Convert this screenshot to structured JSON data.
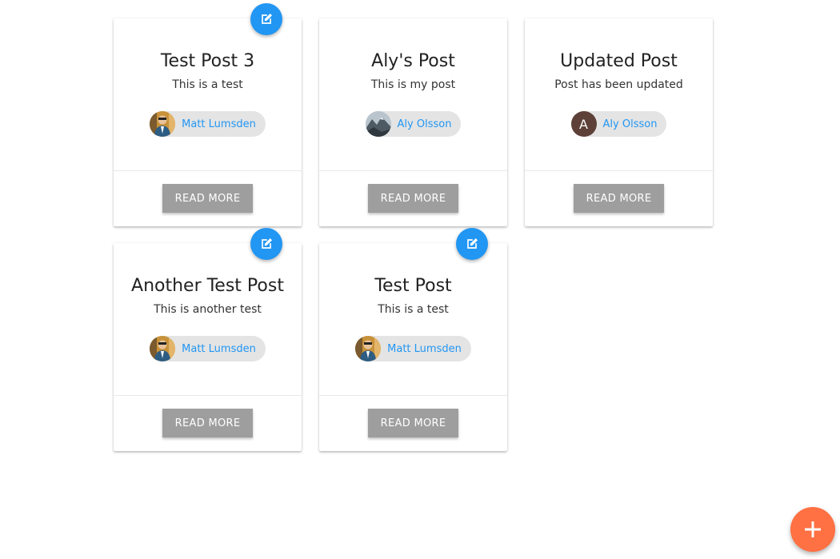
{
  "posts": [
    {
      "title": "Test Post 3",
      "body": "This is a test",
      "author": "Matt Lumsden",
      "avatar": "photo-matt",
      "button": "READ MORE",
      "editable": true
    },
    {
      "title": "Aly's Post",
      "body": "This is my post",
      "author": "Aly Olsson",
      "avatar": "photo-mountain",
      "button": "READ MORE",
      "editable": false
    },
    {
      "title": "Updated Post",
      "body": "Post has been updated",
      "author": "Aly Olsson",
      "avatar": "letter",
      "avatar_letter": "A",
      "button": "READ MORE",
      "editable": false
    },
    {
      "title": "Another Test Post",
      "body": "This is another test",
      "author": "Matt Lumsden",
      "avatar": "photo-matt",
      "button": "READ MORE",
      "editable": true
    },
    {
      "title": "Test Post",
      "body": "This is a test",
      "author": "Matt Lumsden",
      "avatar": "photo-matt",
      "button": "READ MORE",
      "editable": true
    }
  ],
  "icons": {
    "edit": "edit-icon",
    "add": "plus-icon"
  },
  "colors": {
    "accent_blue": "#2196f3",
    "fab_orange": "#ff7043",
    "button_grey": "#9e9e9e",
    "chip_bg": "#e4e4e4",
    "letter_avatar": "#5d4037"
  }
}
